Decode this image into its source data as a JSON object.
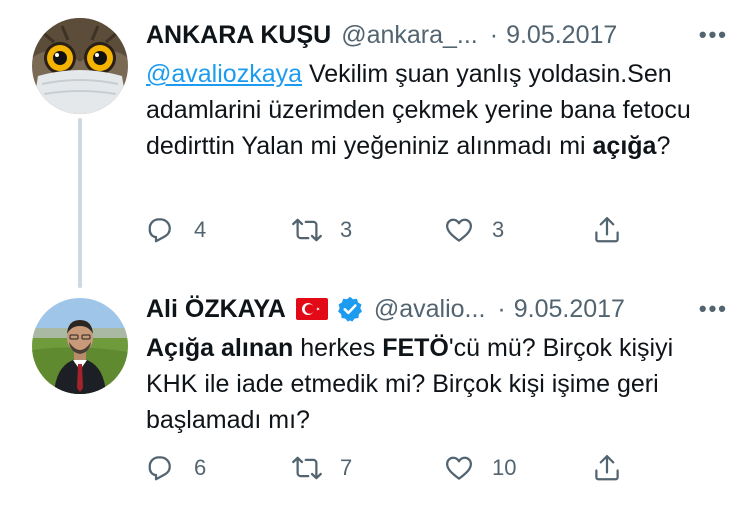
{
  "tweets": [
    {
      "name": "ANKARA KUŞU",
      "handle": "@ankara_...",
      "separator": "·",
      "date": "9.05.2017",
      "more": "•••",
      "body": {
        "mention": "@avaliozkaya",
        "text1": " Vekilim şuan yanlış yoldasin.Sen adamlarini üzerimden çekmek yerine bana fetocu dedirttin Yalan mi yeğeniniz alınmadı mi ",
        "bold1": "açığa",
        "text2": "?"
      },
      "replies": "4",
      "retweets": "3",
      "likes": "3"
    },
    {
      "name": "Ali ÖZKAYA",
      "handle": "@avalio...",
      "separator": "·",
      "date": "9.05.2017",
      "more": "•••",
      "body": {
        "bold1": "Açığa alınan",
        "text1": " herkes ",
        "bold2": "FETÖ",
        "text2": "'cü mü? Birçok kişiyi KHK ile iade etmedik mi? Birçok kişi işime geri başlamadı mı?"
      },
      "replies": "6",
      "retweets": "7",
      "likes": "10"
    }
  ],
  "colors": {
    "link": "#1d9bf0",
    "muted": "#536471",
    "verified": "#1d9bf0",
    "flag_red": "#e30a17"
  },
  "icons": [
    "owl-avatar",
    "person-avatar",
    "turkish-flag-icon",
    "verified-badge-icon",
    "reply-icon",
    "retweet-icon",
    "like-icon",
    "share-icon",
    "more-icon"
  ]
}
